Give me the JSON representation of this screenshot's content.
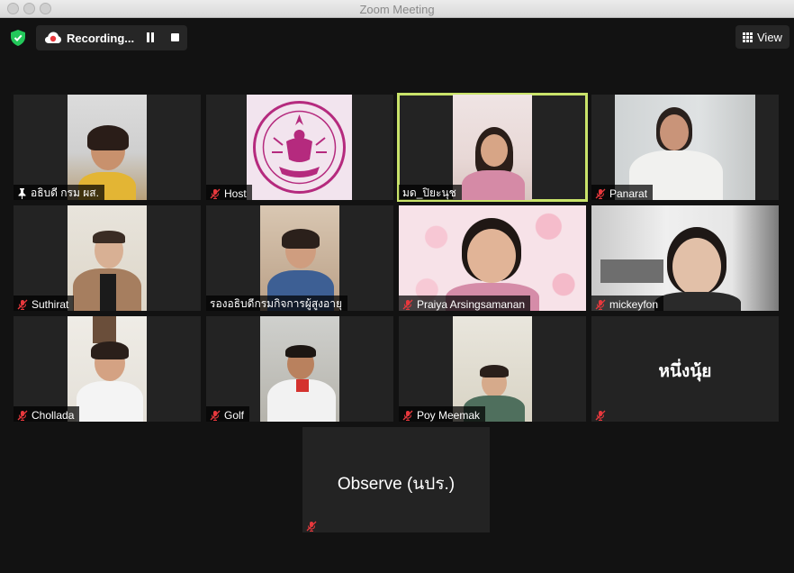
{
  "window": {
    "title": "Zoom Meeting"
  },
  "toolbar": {
    "recording_label": "Recording...",
    "view_label": "View"
  },
  "colors": {
    "active_speaker": "#c9e36a",
    "security_green": "#23c85a",
    "recording_red": "#e8383d",
    "mic_muted_red": "#e8383d"
  },
  "participants": [
    {
      "name": "อธิบดี กรม ผส.",
      "icon": "pin-icon"
    },
    {
      "name": "Host",
      "icon": "mic-muted-icon"
    },
    {
      "name": "มด_ปิยะนุช",
      "icon": "none"
    },
    {
      "name": "Panarat",
      "icon": "mic-muted-icon"
    },
    {
      "name": "Suthirat",
      "icon": "mic-muted-icon"
    },
    {
      "name": "รองอธิบดีกรมกิจการผู้สูงอายุ",
      "icon": "none"
    },
    {
      "name": "Praiya Arsingsamanan",
      "icon": "mic-muted-icon"
    },
    {
      "name": "mickeyfon",
      "icon": "mic-muted-icon"
    },
    {
      "name": "Chollada",
      "icon": "mic-muted-icon"
    },
    {
      "name": "Golf",
      "icon": "mic-muted-icon"
    },
    {
      "name": "Poy Meemak",
      "icon": "mic-muted-icon"
    },
    {
      "name": "หนึ่งนุ้ย",
      "icon": "mic-muted-icon"
    },
    {
      "name": "Observe (นปร.)",
      "icon": "mic-muted-icon"
    }
  ]
}
